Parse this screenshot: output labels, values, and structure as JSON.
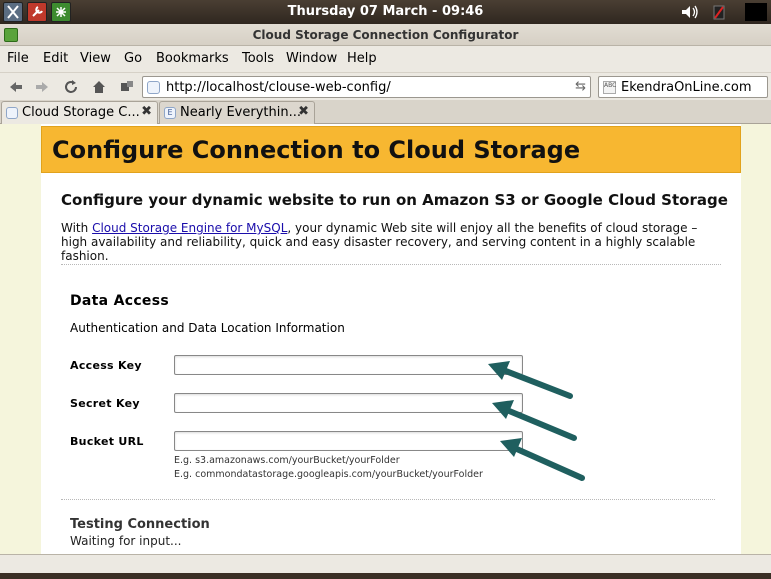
{
  "system_panel": {
    "clock": "Thursday 07 March - 09:46",
    "icons": [
      "x-app-icon",
      "tools-icon",
      "network-icon",
      "volume-icon",
      "battery-icon",
      "power-icon"
    ]
  },
  "window": {
    "title": "Cloud Storage Connection Configurator"
  },
  "menubar": {
    "items": [
      "File",
      "Edit",
      "View",
      "Go",
      "Bookmarks",
      "Tools",
      "Window",
      "Help"
    ]
  },
  "navbar": {
    "url": "http://localhost/clouse-web-config/",
    "search_value": "EkendraOnLine.com"
  },
  "tabs": [
    {
      "label": "Cloud Storage C...",
      "active": true
    },
    {
      "label": "Nearly Everythin...",
      "active": false
    }
  ],
  "page": {
    "header": "Configure Connection to Cloud Storage",
    "subtitle": "Configure your dynamic website to run on Amazon S3 or Google Cloud Storage",
    "intro_prefix": "With ",
    "intro_link": "Cloud Storage Engine for MySQL",
    "intro_suffix": ", your dynamic Web site will enjoy all the benefits of cloud storage – high availability and reliability, quick and easy disaster recovery, and serving content in a highly scalable fashion.",
    "data_access": {
      "title": "Data Access",
      "subtitle": "Authentication and Data Location Information",
      "fields": [
        {
          "label": "Access Key",
          "value": ""
        },
        {
          "label": "Secret Key",
          "value": ""
        },
        {
          "label": "Bucket URL",
          "value": ""
        }
      ],
      "hints": [
        "E.g. s3.amazonaws.com/yourBucket/yourFolder",
        "E.g. commondatastorage.googleapis.com/yourBucket/yourFolder"
      ]
    },
    "testing": {
      "title": "Testing Connection",
      "status": "Waiting for input..."
    }
  },
  "colors": {
    "header_band": "#f7b731",
    "page_background": "#f5f5dc",
    "arrow": "#1f5f5f",
    "link": "#1a0dab"
  }
}
